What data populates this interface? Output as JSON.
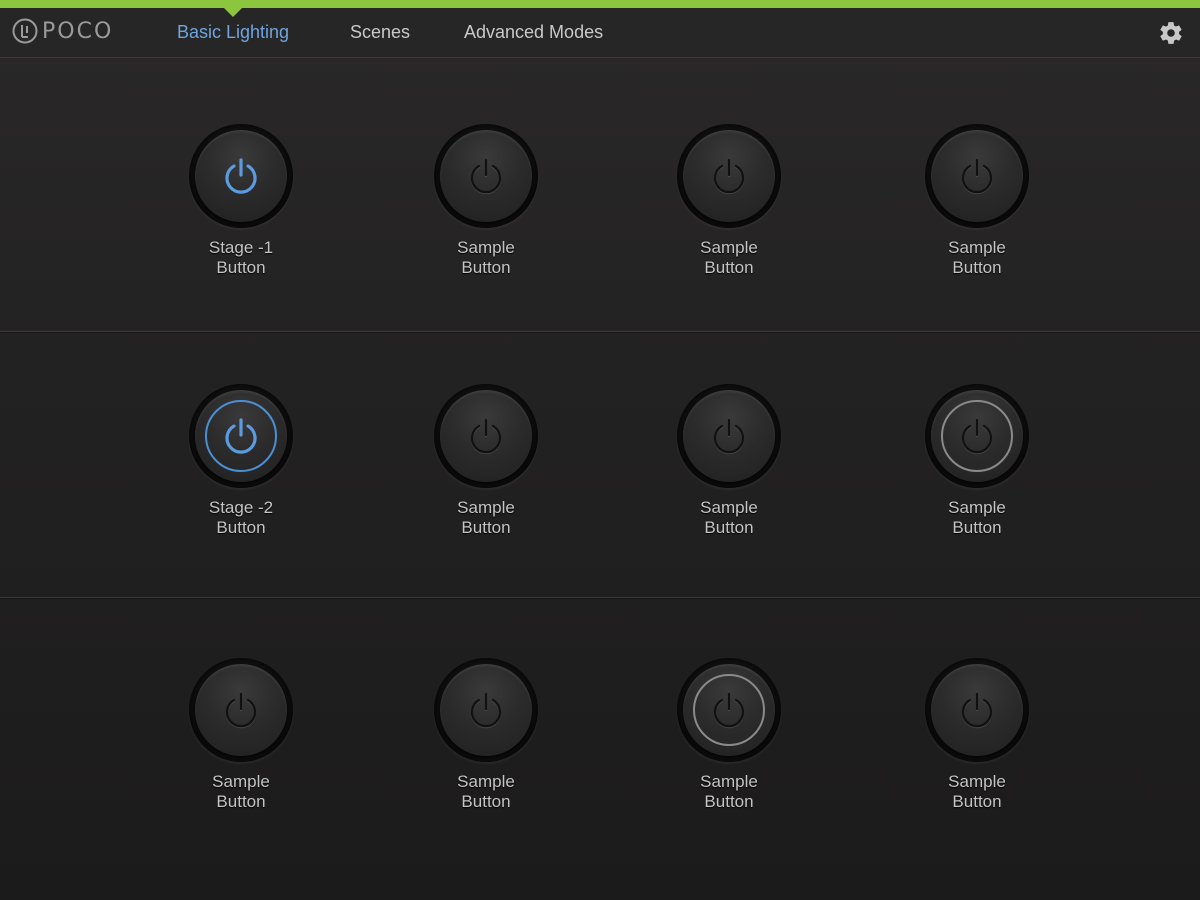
{
  "header": {
    "logo_text": "POCO",
    "tabs": [
      {
        "label": "Basic Lighting",
        "active": true
      },
      {
        "label": "Scenes",
        "active": false
      },
      {
        "label": "Advanced Modes",
        "active": false
      }
    ],
    "settings_icon": "gear-icon"
  },
  "colors": {
    "accent": "#8cc63f",
    "active_tab": "#6ea4e0",
    "power_on": "#5b9be0"
  },
  "rows": [
    {
      "buttons": [
        {
          "line1": "Stage -1",
          "line2": "Button",
          "state": "on"
        },
        {
          "line1": "Sample",
          "line2": "Button",
          "state": "off"
        },
        {
          "line1": "Sample",
          "line2": "Button",
          "state": "off"
        },
        {
          "line1": "Sample",
          "line2": "Button",
          "state": "off"
        }
      ]
    },
    {
      "buttons": [
        {
          "line1": "Stage -2",
          "line2": "Button",
          "state": "on-ring"
        },
        {
          "line1": "Sample",
          "line2": "Button",
          "state": "off"
        },
        {
          "line1": "Sample",
          "line2": "Button",
          "state": "off"
        },
        {
          "line1": "Sample",
          "line2": "Button",
          "state": "ring"
        }
      ]
    },
    {
      "buttons": [
        {
          "line1": "Sample",
          "line2": "Button",
          "state": "off"
        },
        {
          "line1": "Sample",
          "line2": "Button",
          "state": "off"
        },
        {
          "line1": "Sample",
          "line2": "Button",
          "state": "ring"
        },
        {
          "line1": "Sample",
          "line2": "Button",
          "state": "off"
        }
      ]
    }
  ]
}
